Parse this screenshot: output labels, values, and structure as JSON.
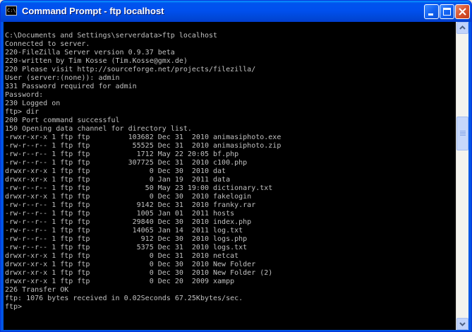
{
  "window": {
    "title": "Command Prompt - ftp localhost",
    "icon": "cmd-icon",
    "icon_text": "C:\\"
  },
  "console": {
    "lines": [
      "C:\\Documents and Settings\\serverdata>ftp localhost",
      "Connected to server.",
      "220-FileZilla Server version 0.9.37 beta",
      "220-written by Tim Kosse (Tim.Kosse@gmx.de)",
      "220 Please visit http://sourceforge.net/projects/filezilla/",
      "User (server:(none)): admin",
      "331 Password required for admin",
      "Password:",
      "230 Logged on",
      "ftp> dir",
      "200 Port command successful",
      "150 Opening data channel for directory list.",
      "-rwxr-xr-x 1 ftp ftp         103682 Dec 31  2010 animasiphoto.exe",
      "-rw-r--r-- 1 ftp ftp          55525 Dec 31  2010 animasiphoto.zip",
      "-rw-r--r-- 1 ftp ftp           1712 May 22 20:05 bf.php",
      "-rw-r--r-- 1 ftp ftp         307725 Dec 31  2010 c100.php",
      "drwxr-xr-x 1 ftp ftp              0 Dec 30  2010 dat",
      "drwxr-xr-x 1 ftp ftp              0 Jan 19  2011 data",
      "-rw-r--r-- 1 ftp ftp             50 May 23 19:00 dictionary.txt",
      "drwxr-xr-x 1 ftp ftp              0 Dec 30  2010 fakelogin",
      "-rw-r--r-- 1 ftp ftp           9142 Dec 31  2010 franky.rar",
      "-rw-r--r-- 1 ftp ftp           1005 Jan 01  2011 hosts",
      "-rw-r--r-- 1 ftp ftp          29840 Dec 30  2010 index.php",
      "-rw-r--r-- 1 ftp ftp          14065 Jan 14  2011 log.txt",
      "-rw-r--r-- 1 ftp ftp            912 Dec 30  2010 logs.php",
      "-rw-r--r-- 1 ftp ftp           5375 Dec 31  2010 logs.txt",
      "drwxr-xr-x 1 ftp ftp              0 Dec 31  2010 netcat",
      "drwxr-xr-x 1 ftp ftp              0 Dec 30  2010 New Folder",
      "drwxr-xr-x 1 ftp ftp              0 Dec 30  2010 New Folder (2)",
      "drwxr-xr-x 1 ftp ftp              0 Dec 20  2009 xampp",
      "226 Transfer OK",
      "ftp: 1076 bytes received in 0.02Seconds 67.25Kbytes/sec.",
      "ftp>"
    ]
  },
  "colors": {
    "titlebar": "#0054e3",
    "console_bg": "#000000",
    "console_text": "#c0c0c0"
  }
}
